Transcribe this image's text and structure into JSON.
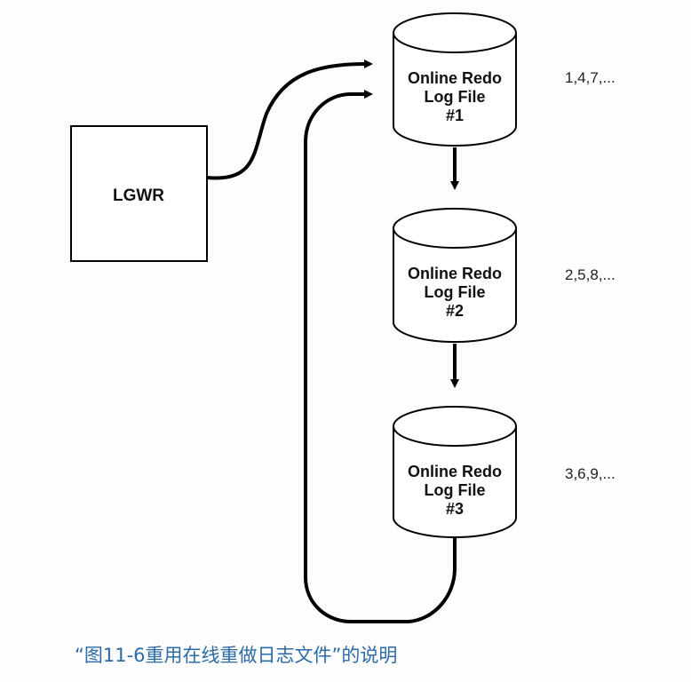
{
  "lgwr": {
    "label": "LGWR"
  },
  "log_files": [
    {
      "line1": "Online Redo",
      "line2": "Log File",
      "line3": "#1",
      "sequence": "1,4,7,..."
    },
    {
      "line1": "Online Redo",
      "line2": "Log File",
      "line3": "#2",
      "sequence": "2,5,8,..."
    },
    {
      "line1": "Online Redo",
      "line2": "Log File",
      "line3": "#3",
      "sequence": "3,6,9,..."
    }
  ],
  "caption": "“图11-6重用在线重做日志文件”的说明",
  "colors": {
    "caption": "#2c6aa6",
    "stroke": "#000000",
    "cylinder_fill": "#ffffff"
  }
}
